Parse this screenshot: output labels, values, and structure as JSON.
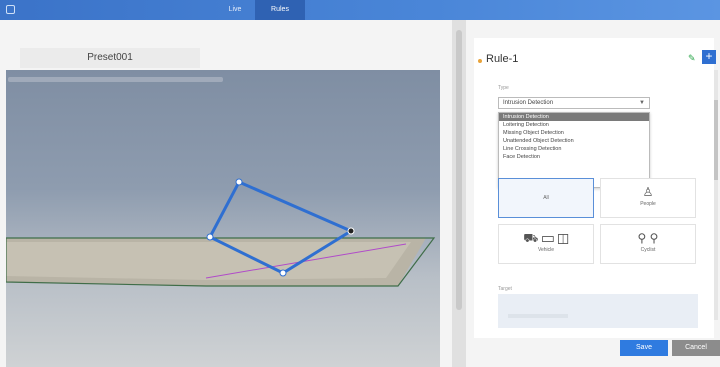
{
  "topbar": {
    "tabs": [
      {
        "label": "Live"
      },
      {
        "label": "Rules"
      }
    ]
  },
  "preview": {
    "preset_label": "Preset001"
  },
  "rule_panel": {
    "rule_name": "Rule-1",
    "edit_icon": "pencil-icon",
    "add_icon": "plus-icon",
    "type_field": {
      "label": "Type",
      "selected": "Intrusion Detection",
      "options": [
        "Intrusion Detection",
        "Loitering Detection",
        "Missing Object Detection",
        "Unattended Object Detection",
        "Line Crossing Detection",
        "Face Detection"
      ]
    },
    "filter_tiles": [
      {
        "label": "All",
        "icon": ""
      },
      {
        "label": "People",
        "icon": "person-icon"
      },
      {
        "label": "Vehicle",
        "icon": "vehicle-icon"
      },
      {
        "label": "Cyclist",
        "icon": "cyclist-icon"
      }
    ],
    "target": {
      "label": "Target"
    },
    "buttons": {
      "save": "Save",
      "cancel": "Cancel"
    }
  },
  "colors": {
    "accent": "#2f7be0",
    "topbar": "#4a86d8",
    "roi_line": "#2f6fd1",
    "rule_dot": "#e8a33a"
  }
}
